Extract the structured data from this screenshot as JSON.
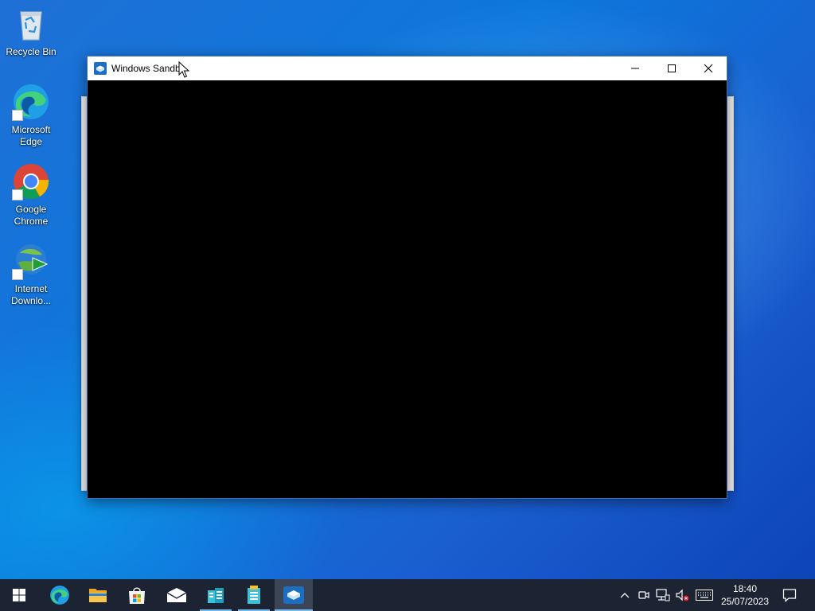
{
  "desktop": {
    "icons": [
      {
        "label": "Recycle Bin",
        "icon": "recycle-bin-icon"
      },
      {
        "label": "Microsoft Edge",
        "icon": "edge-icon"
      },
      {
        "label": "Google Chrome",
        "icon": "chrome-icon"
      },
      {
        "label": "Internet Downlo...",
        "icon": "idm-icon"
      }
    ]
  },
  "window": {
    "title": "Windows Sandb",
    "icon": "sandbox-icon",
    "controls": {
      "minimize": "minimize-icon",
      "maximize": "maximize-icon",
      "close": "close-icon"
    }
  },
  "taskbar": {
    "apps": [
      {
        "name": "Start",
        "icon": "windows-logo-icon"
      },
      {
        "name": "Microsoft Edge",
        "icon": "edge-icon"
      },
      {
        "name": "File Explorer",
        "icon": "folder-icon"
      },
      {
        "name": "Microsoft Store",
        "icon": "store-icon"
      },
      {
        "name": "Mail",
        "icon": "mail-icon"
      },
      {
        "name": "App",
        "icon": "app-icon"
      },
      {
        "name": "App",
        "icon": "app-icon"
      },
      {
        "name": "Windows Sandbox",
        "icon": "sandbox-icon"
      }
    ],
    "tray": [
      "chevron-up-icon",
      "meet-now-icon",
      "network-icon",
      "volume-muted-icon",
      "keyboard-icon"
    ],
    "clock": {
      "time": "18:40",
      "date": "25/07/2023"
    },
    "notification_icon": "action-center-icon"
  },
  "colors": {
    "taskbar": "#1c2433",
    "accent": "#76b9ed",
    "desktop": "#0a6ed8"
  }
}
